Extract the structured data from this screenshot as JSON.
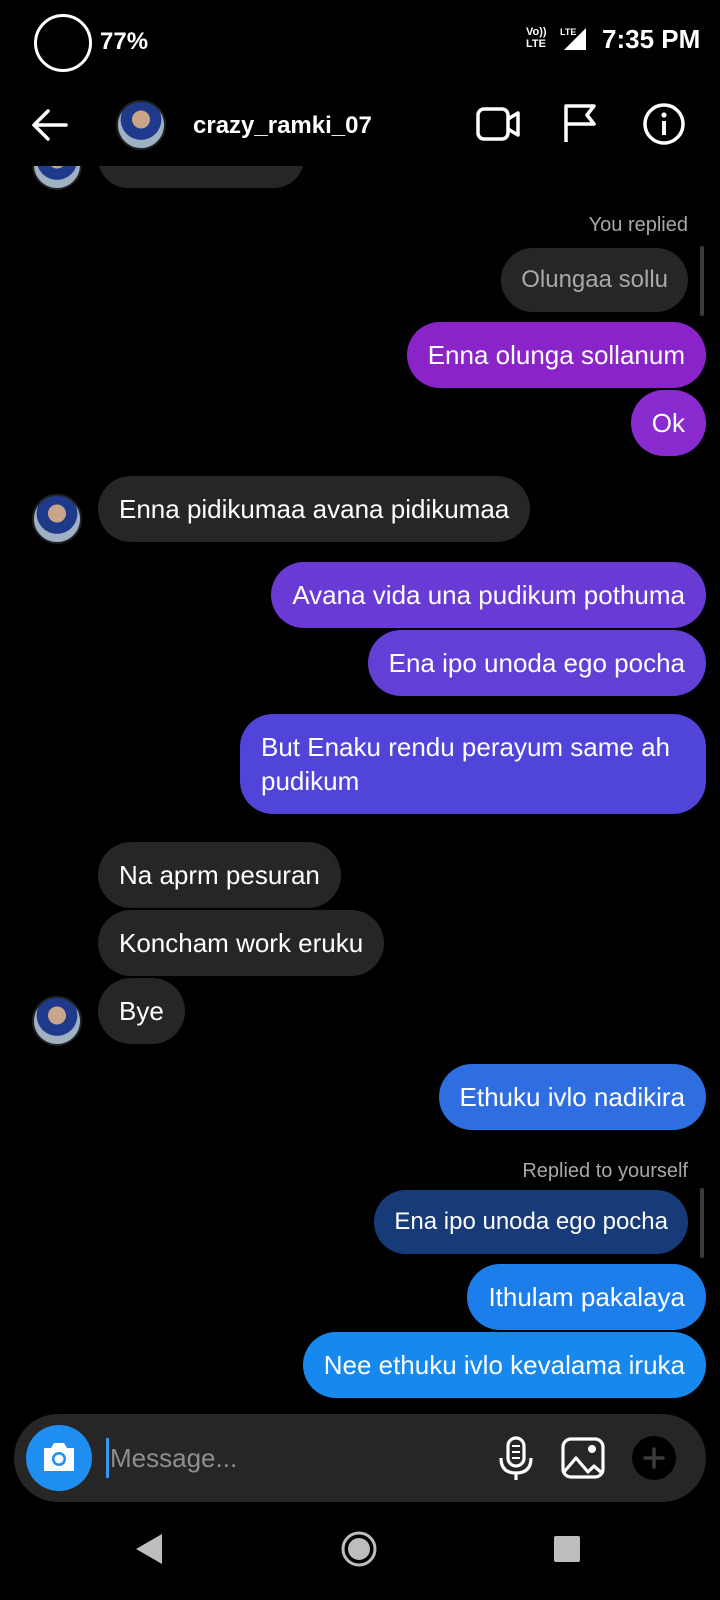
{
  "status_bar": {
    "battery": "77%",
    "network_line1": "Vo))",
    "network_line2": "LTE",
    "network_badge": "LTE",
    "time": "7:35 PM"
  },
  "header": {
    "contact_name": "crazy_ramki_07",
    "icons": [
      "back-arrow-icon",
      "avatar",
      "video-call-icon",
      "flag-icon",
      "info-icon"
    ]
  },
  "chat": {
    "reply_label_1": "You replied",
    "quoted_1": "Olungaa sollu",
    "messages": [
      {
        "id": "m1",
        "text": "Enna olunga sollanum"
      },
      {
        "id": "m2",
        "text": "Ok"
      },
      {
        "id": "m3",
        "text": "Enna pidikumaa avana pidikumaa"
      },
      {
        "id": "m4",
        "text": "Avana vida una pudikum pothuma"
      },
      {
        "id": "m5",
        "text": "Ena ipo unoda ego pocha"
      },
      {
        "id": "m6",
        "line1": "But Enaku rendu perayum same ah",
        "line2": "pudikum"
      },
      {
        "id": "m7",
        "text": "Na aprm pesuran"
      },
      {
        "id": "m8",
        "text": "Koncham work eruku"
      },
      {
        "id": "m9",
        "text": "Bye"
      },
      {
        "id": "m10",
        "text": "Ethuku ivlo nadikira"
      },
      {
        "id": "m11",
        "text": "Ithulam pakalaya"
      },
      {
        "id": "m12",
        "text": "Nee ethuku ivlo kevalama iruka"
      }
    ],
    "reply_label_2": "Replied to yourself",
    "quoted_2": "Ena ipo unoda ego pocha"
  },
  "composer": {
    "placeholder": "Message...",
    "icons": [
      "camera-icon",
      "microphone-icon",
      "gallery-icon",
      "plus-icon"
    ]
  },
  "colors": {
    "background": "#000000",
    "incoming_bubble": "#262626",
    "sent_purple": "#8b24c8",
    "sent_violet": "#6a3ad4",
    "sent_indigo": "#5144d8",
    "sent_blue": "#2f6ee0",
    "sent_sky": "#1688ee",
    "quoted_self": "#173a78",
    "accent": "#1f8ef1"
  }
}
